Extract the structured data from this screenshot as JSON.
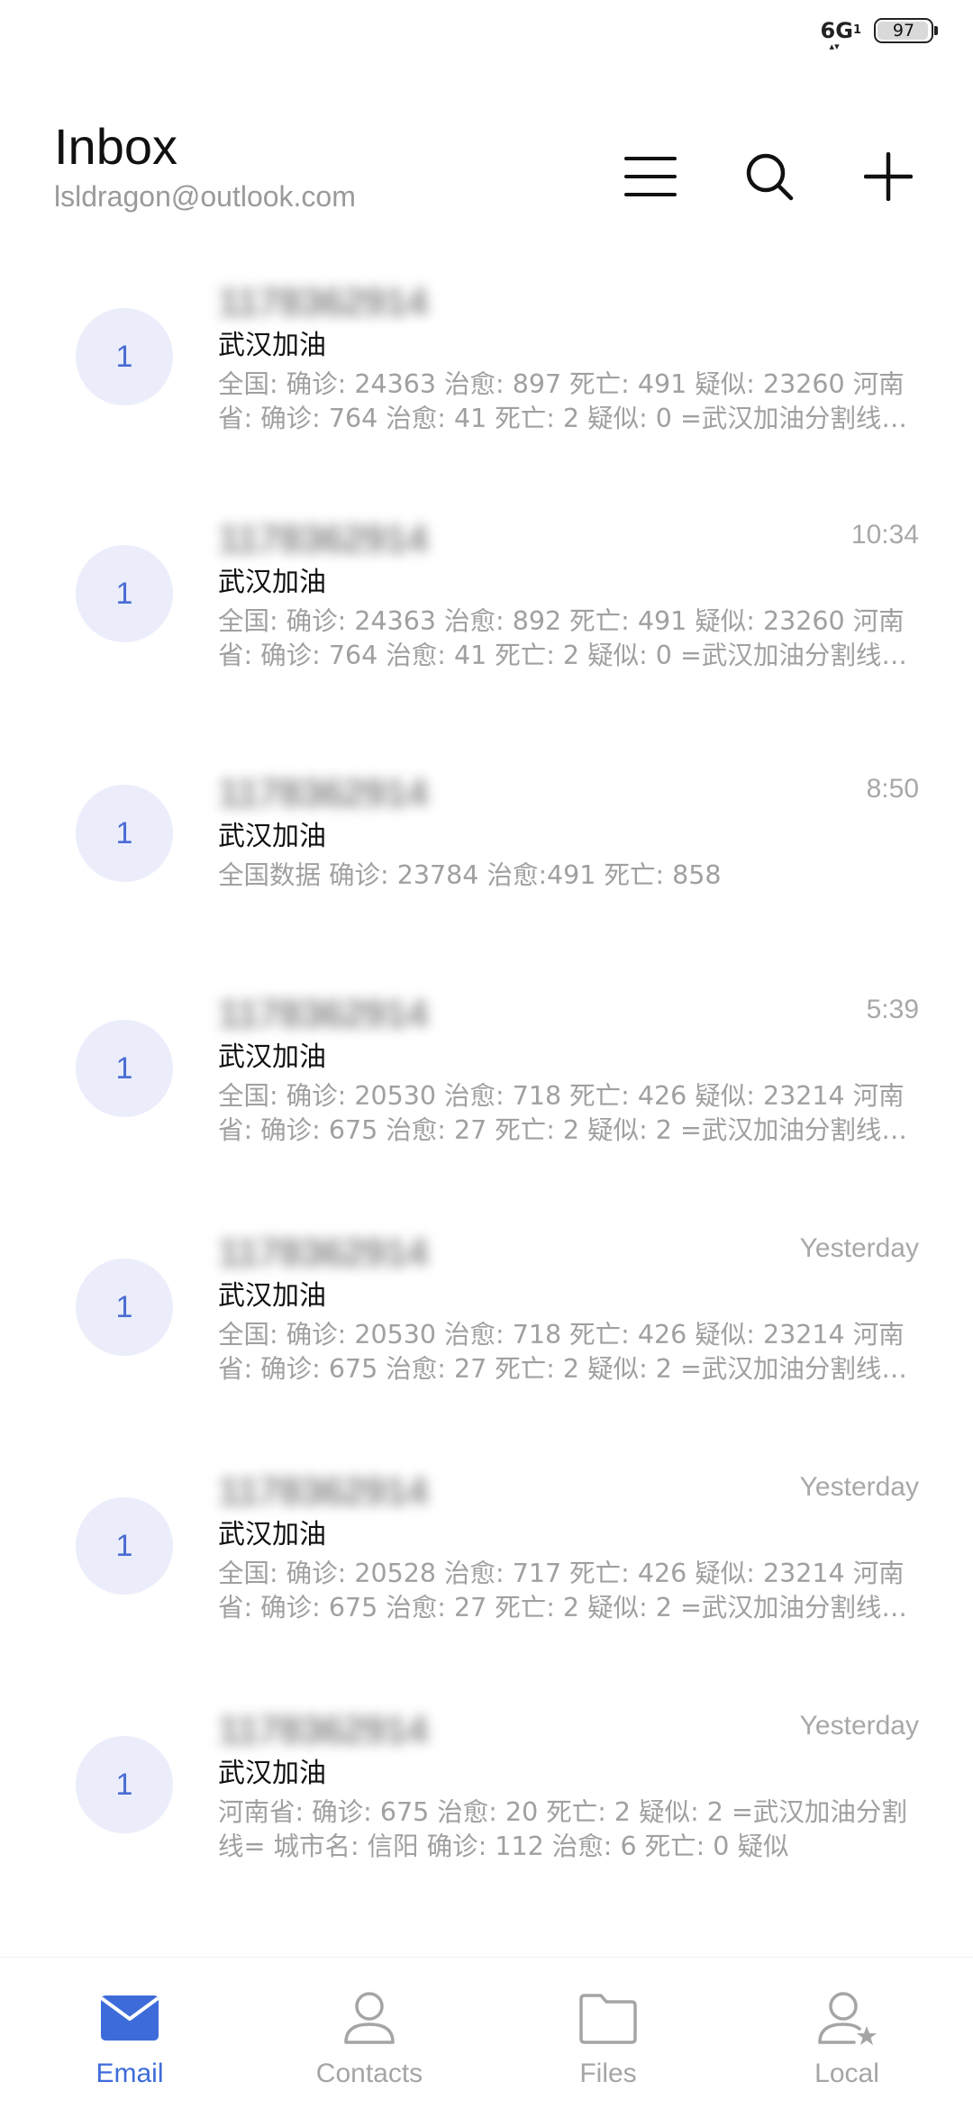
{
  "status_bar": {
    "network": "6G",
    "network_sub": "1",
    "battery_level": "97",
    "battery_fraction": 0.97
  },
  "header": {
    "title": "Inbox",
    "account": "lsldragon@outlook.com",
    "menu_icon": "menu-icon",
    "search_icon": "search-icon",
    "add_icon": "plus-icon"
  },
  "emails": [
    {
      "avatar": "1",
      "sender": "1178362914",
      "time": "",
      "subject": "武汉加油",
      "preview": "全国: 确诊: 24363 治愈: 897 死亡: 491 疑似: 23260 河南省:  确诊:  764 治愈:  41 死亡:  2 疑似:  0 =武汉加油分割线= 城市名"
    },
    {
      "avatar": "1",
      "sender": "1178362914",
      "time": "10:34",
      "subject": "武汉加油",
      "preview": "全国: 确诊: 24363 治愈: 892 死亡: 491 疑似: 23260 河南省:  确诊:  764 治愈:  41 死亡:  2 疑似:  0 =武汉加油分割线= 城市名"
    },
    {
      "avatar": "1",
      "sender": "1178362914",
      "time": "8:50",
      "subject": "武汉加油",
      "preview": "全国数据 确诊: 23784 治愈:491 死亡: 858"
    },
    {
      "avatar": "1",
      "sender": "1178362914",
      "time": "5:39",
      "subject": "武汉加油",
      "preview": "全国: 确诊: 20530 治愈: 718 死亡: 426 疑似: 23214 河南省:  确诊:  675 治愈:  27 死亡:  2 疑似:  2 =武汉加油分割线= 城市名"
    },
    {
      "avatar": "1",
      "sender": "1178362914",
      "time": "Yesterday",
      "subject": "武汉加油",
      "preview": "全国: 确诊: 20530 治愈: 718 死亡: 426 疑似: 23214 河南省:  确诊:  675 治愈:  27 死亡:  2 疑似:  2 =武汉加油分割线= 城市名"
    },
    {
      "avatar": "1",
      "sender": "1178362914",
      "time": "Yesterday",
      "subject": "武汉加油",
      "preview": "全国: 确诊: 20528 治愈: 717 死亡: 426 疑似: 23214 河南省:  确诊:  675 治愈:  27 死亡:  2 疑似:  2 =武汉加油分割线= 城市名"
    },
    {
      "avatar": "1",
      "sender": "1178362914",
      "time": "Yesterday",
      "subject": "武汉加油",
      "preview": "河南省:  确诊:  675 治愈:  20 死亡:  2 疑似:  2 =武汉加油分割线= 城市名: 信阳 确诊: 112 治愈: 6 死亡: 0 疑似"
    }
  ],
  "bottom_nav": {
    "items": [
      {
        "label": "Email",
        "icon": "envelope-icon",
        "active": true
      },
      {
        "label": "Contacts",
        "icon": "person-icon",
        "active": false
      },
      {
        "label": "Files",
        "icon": "folder-icon",
        "active": false
      },
      {
        "label": "Local",
        "icon": "local-user-star-icon",
        "active": false
      }
    ]
  },
  "colors": {
    "accent": "#3d6bd9",
    "avatar_bg": "#ebedfb",
    "muted_text": "#a0a0a0"
  }
}
